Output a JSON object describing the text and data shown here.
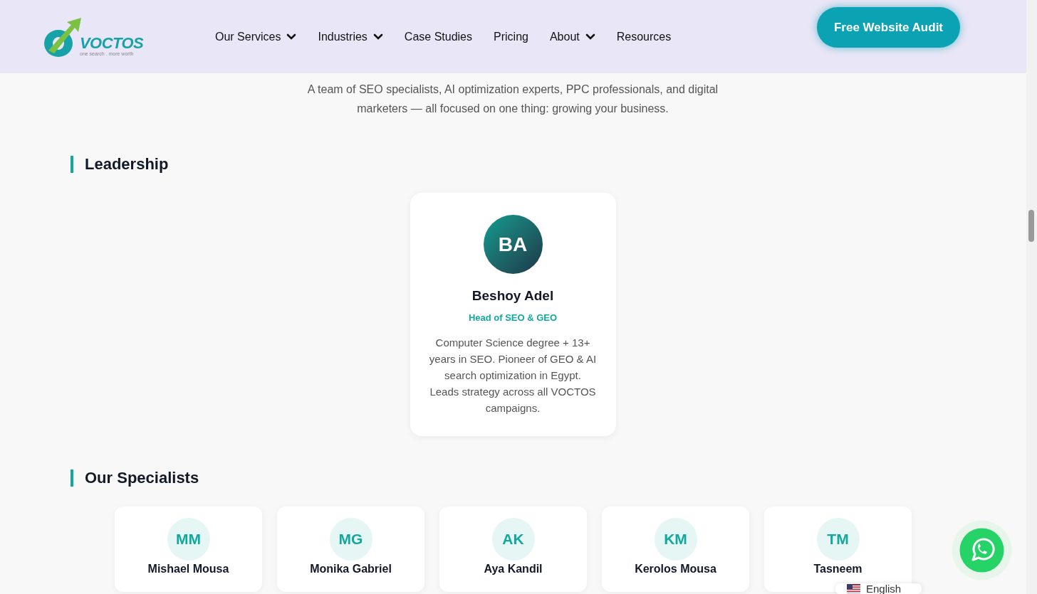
{
  "header": {
    "logo": {
      "name": "VOCTOS",
      "tagline": "one search . more worth"
    },
    "nav": [
      {
        "label": "Our Services",
        "dropdown": true
      },
      {
        "label": "Industries",
        "dropdown": true
      },
      {
        "label": "Case Studies",
        "dropdown": false
      },
      {
        "label": "Pricing",
        "dropdown": false
      },
      {
        "label": "About",
        "dropdown": true
      },
      {
        "label": "Resources",
        "dropdown": false
      }
    ],
    "cta": "Free Website Audit"
  },
  "intro": "A team of SEO specialists, AI optimization experts, PPC professionals, and digital marketers — all focused on one thing: growing your business.",
  "leadership": {
    "heading": "Leadership",
    "members": [
      {
        "initials": "BA",
        "name": "Beshoy Adel",
        "role": "Head of SEO & GEO",
        "bio": "Computer Science degree + 13+ years in SEO. Pioneer of GEO & AI search optimization in Egypt. Leads strategy across all VOCTOS campaigns."
      }
    ]
  },
  "specialists": {
    "heading": "Our Specialists",
    "members": [
      {
        "initials": "MM",
        "name": "Mishael Mousa"
      },
      {
        "initials": "MG",
        "name": "Monika Gabriel"
      },
      {
        "initials": "AK",
        "name": "Aya Kandil"
      },
      {
        "initials": "KM",
        "name": "Kerolos Mousa"
      },
      {
        "initials": "TM",
        "name": "Tasneem"
      }
    ]
  },
  "language": {
    "label": "English"
  }
}
